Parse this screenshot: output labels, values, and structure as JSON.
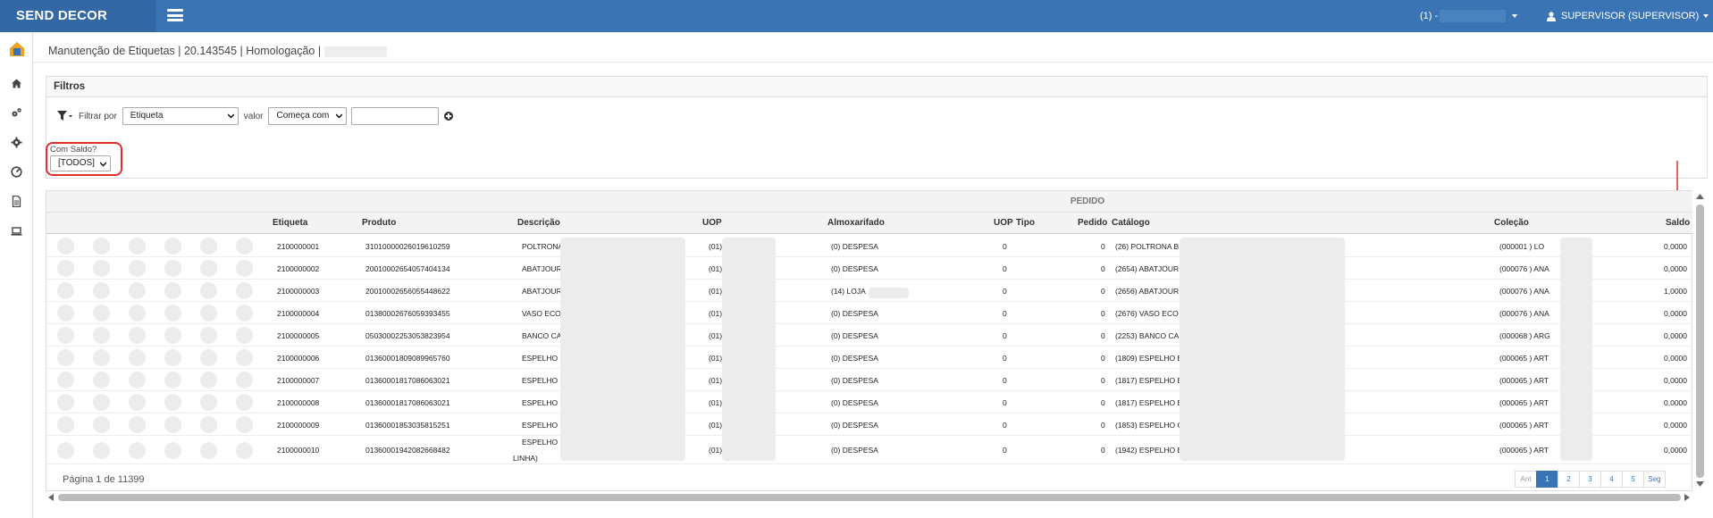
{
  "app": {
    "brand": "SEND DECOR",
    "company_prefix": "(1) -",
    "user": "SUPERVISOR (SUPERVISOR)"
  },
  "page": {
    "title": "Manutenção de Etiquetas | 20.143545 | Homologação |"
  },
  "filters": {
    "section_title": "Filtros",
    "filter_by_label": "Filtrar por",
    "filter_by_value": "Etiqueta",
    "value_label": "valor",
    "operator_value": "Começa com",
    "text_value": "",
    "com_saldo_label": "Com Saldo?",
    "com_saldo_value": "[TODOS]"
  },
  "grid": {
    "group_header": "PEDIDO",
    "columns": [
      "Etiqueta",
      "Produto",
      "Descrição",
      "UOP",
      "Almoxarifado",
      "UOP",
      "Tipo",
      "Pedido",
      "Catálogo",
      "Coleção",
      "Saldo"
    ],
    "rows": [
      {
        "etiqueta": "2100000001",
        "produto": "31010000026019610259",
        "descricao": "POLTRONA",
        "uop": "(01)",
        "almox": "(0) DESPESA",
        "uop2": "0",
        "pedido": "0",
        "catalogo": "(26) POLTRONA B",
        "colecao": "(000001 ) LO",
        "saldo": "0,0000"
      },
      {
        "etiqueta": "2100000002",
        "produto": "20010002654057404134",
        "descricao": "ABATJOUR",
        "uop": "(01)",
        "almox": "(0) DESPESA",
        "uop2": "0",
        "pedido": "0",
        "catalogo": "(2654) ABATJOUR",
        "colecao": "(000076 ) ANA",
        "saldo": "0,0000"
      },
      {
        "etiqueta": "2100000003",
        "produto": "20010002656055448622",
        "descricao": "ABATJOUR",
        "uop": "(01)",
        "almox": "(14) LOJA",
        "uop2": "0",
        "pedido": "0",
        "catalogo": "(2656) ABATJOUR",
        "colecao": "(000076 ) ANA",
        "saldo": "1,0000"
      },
      {
        "etiqueta": "2100000004",
        "produto": "01380002676059393455",
        "descricao": "VASO ECO",
        "uop": "(01)",
        "almox": "(0) DESPESA",
        "uop2": "0",
        "pedido": "0",
        "catalogo": "(2676) VASO ECO",
        "colecao": "(000076 ) ANA",
        "saldo": "0,0000"
      },
      {
        "etiqueta": "2100000005",
        "produto": "05030002253053823954",
        "descricao": "BANCO CA",
        "uop": "(01)",
        "almox": "(0) DESPESA",
        "uop2": "0",
        "pedido": "0",
        "catalogo": "(2253) BANCO CA",
        "colecao": "(000068 ) ARG",
        "saldo": "0,0000"
      },
      {
        "etiqueta": "2100000006",
        "produto": "01360001809089965760",
        "descricao": "ESPELHO E",
        "uop": "(01)",
        "almox": "(0) DESPESA",
        "uop2": "0",
        "pedido": "0",
        "catalogo": "(1809) ESPELHO E",
        "colecao": "(000065 ) ART",
        "saldo": "0,0000"
      },
      {
        "etiqueta": "2100000007",
        "produto": "01360001817086063021",
        "descricao": "ESPELHO E",
        "uop": "(01)",
        "almox": "(0) DESPESA",
        "uop2": "0",
        "pedido": "0",
        "catalogo": "(1817) ESPELHO E",
        "colecao": "(000065 ) ART",
        "saldo": "0,0000"
      },
      {
        "etiqueta": "2100000008",
        "produto": "01360001817086063021",
        "descricao": "ESPELHO E",
        "uop": "(01)",
        "almox": "(0) DESPESA",
        "uop2": "0",
        "pedido": "0",
        "catalogo": "(1817) ESPELHO E",
        "colecao": "(000065 ) ART",
        "saldo": "0,0000"
      },
      {
        "etiqueta": "2100000009",
        "produto": "01360001853035815251",
        "descricao": "ESPELHO C",
        "uop": "(01)",
        "almox": "(0) DESPESA",
        "uop2": "0",
        "pedido": "0",
        "catalogo": "(1853) ESPELHO C",
        "colecao": "(000065 ) ART",
        "saldo": "0,0000"
      },
      {
        "etiqueta": "2100000010",
        "produto": "01360001942082668482",
        "descricao": "ESPELHO E",
        "descricao2": "LINHA)",
        "uop": "(01)",
        "almox": "(0) DESPESA",
        "uop2": "0",
        "pedido": "0",
        "catalogo": "(1942) ESPELHO E",
        "colecao": "(000065 ) ART",
        "saldo": "0,0000"
      }
    ],
    "pagination_text": "Página 1 de 11399",
    "pages": [
      "Ant",
      "1",
      "2",
      "3",
      "4",
      "5",
      "Seg"
    ]
  },
  "colors": {
    "topbar": "#3a74b4",
    "brand_bg": "#3368a5",
    "highlight": "#e0302e"
  }
}
